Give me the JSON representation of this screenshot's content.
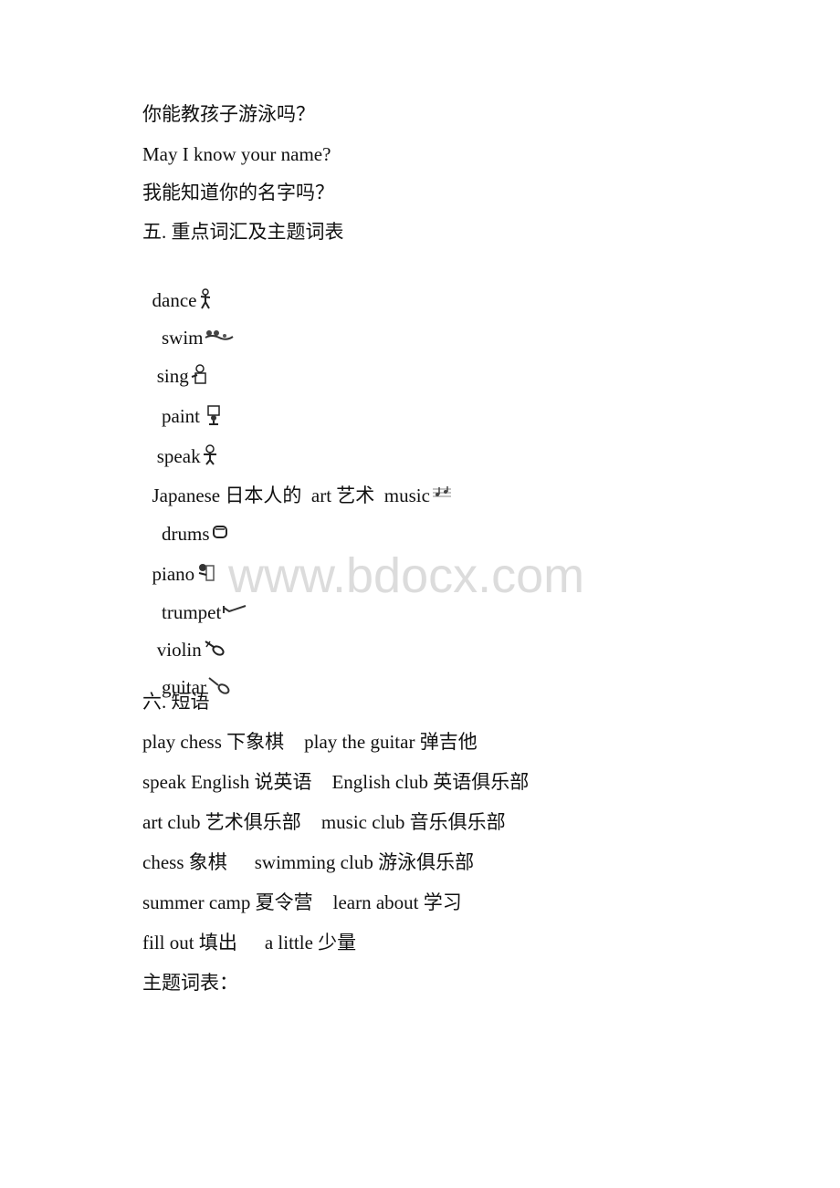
{
  "sentences": [
    "你能教孩子游泳吗？",
    "May I know your name?",
    "我能知道你的名字吗？"
  ],
  "section5": {
    "heading": "五. 重点词汇及主题词表",
    "words": [
      {
        "word": "dance",
        "icon": "dancing-figure-icon",
        "indent": ""
      },
      {
        "word": "swim",
        "icon": "swimmers-icon",
        "indent": "  "
      },
      {
        "word": "sing",
        "icon": "singer-icon",
        "indent": " "
      },
      {
        "word": "paint",
        "icon": "painter-icon",
        "indent": "  "
      },
      {
        "word": "speak",
        "icon": "speaker-icon",
        "indent": " "
      }
    ],
    "mixed_line": {
      "w1": "Japanese",
      "w1_cn": "日本人的",
      "w2": "art",
      "w2_cn": "艺术",
      "w3": "music",
      "icon": "music-notes-icon"
    },
    "instruments": [
      {
        "word": "drums",
        "icon": "drum-icon",
        "indent": "  "
      },
      {
        "word": "piano",
        "icon": "piano-icon",
        "indent": ""
      },
      {
        "word": "trumpet",
        "icon": "trumpet-icon",
        "indent": "  "
      },
      {
        "word": "violin",
        "icon": "violin-icon",
        "indent": " "
      },
      {
        "word": "guitar",
        "icon": "guitar-icon",
        "indent": "  "
      }
    ]
  },
  "section6": {
    "heading": "六. 短语",
    "phrases": [
      {
        "a": "play chess 下象棋",
        "b": "play the guitar 弹吉他"
      },
      {
        "a": "speak English 说英语",
        "b": "English club 英语俱乐部"
      },
      {
        "a": "art club 艺术俱乐部",
        "b": "music club 音乐俱乐部"
      },
      {
        "a": "chess 象棋",
        "b": "swimming club 游泳俱乐部"
      },
      {
        "a": "summer camp 夏令营",
        "b": "learn about 学习"
      },
      {
        "a": "fill out 填出",
        "b": "a little 少量"
      }
    ],
    "theme_heading": "主题词表："
  },
  "watermark": "www.bdocx.com"
}
